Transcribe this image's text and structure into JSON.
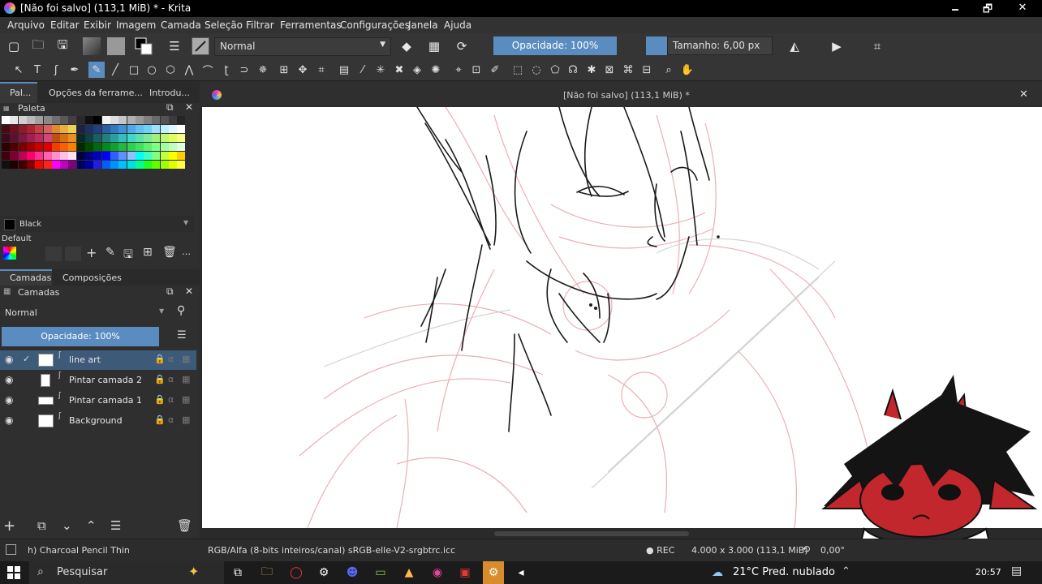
{
  "window": {
    "title": "[Não foi salvo]  (113,1 MiB) * - Krita",
    "minimize": "🗕",
    "maximize": "🗗",
    "close": "✕"
  },
  "menu": [
    "Arquivo",
    "Editar",
    "Exibir",
    "Imagem",
    "Camada",
    "Seleção",
    "Filtrar",
    "Ferramentas",
    "Configurações",
    "Janela",
    "Ajuda"
  ],
  "toolbar": {
    "blend_mode": "Normal",
    "opacity": "Opacidade: 100%",
    "size": "Tamanho: 6,00 px"
  },
  "left_tabs": [
    "Pal...",
    "Opções da ferrame...",
    "Introdu..."
  ],
  "palette": {
    "title": "Paleta",
    "selected_color": "Black",
    "set_name": "Default"
  },
  "layers_panel": {
    "tabs": [
      "Camadas",
      "Composições"
    ],
    "title": "Camadas",
    "blend": "Normal",
    "opacity": "Opacidade:  100%",
    "layers": [
      {
        "name": "line art",
        "selected": true
      },
      {
        "name": "Pintar camada 2",
        "selected": false
      },
      {
        "name": "Pintar camada 1",
        "selected": false
      },
      {
        "name": "Background",
        "selected": false
      }
    ]
  },
  "document_tab": "[Não foi salvo]  (113,1 MiB) *",
  "status": {
    "brush": "h) Charcoal Pencil Thin",
    "colorspace": "RGB/Alfa (8-bits inteiros/canal)  sRGB-elle-V2-srgbtrc.icc",
    "rec": "● REC",
    "dimensions": "4.000 x 3.000 (113,1 MiB)",
    "rotation": "0,00°"
  },
  "taskbar": {
    "search": "Pesquisar",
    "weather": "21°C  Pred. nublado",
    "time": "20:57"
  },
  "colors": {
    "accent": "#5a8cc0",
    "selection": "#3d5a78"
  }
}
